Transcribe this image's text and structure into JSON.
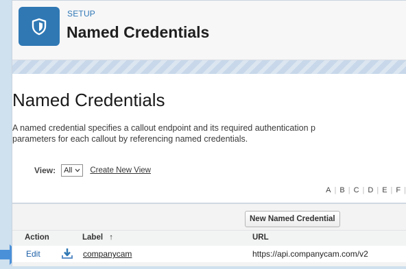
{
  "header": {
    "kicker": "SETUP",
    "title": "Named Credentials"
  },
  "page": {
    "title": "Named Credentials",
    "description_line1": "A named credential specifies a callout endpoint and its required authentication p",
    "description_line2": "parameters for each callout by referencing named credentials."
  },
  "view": {
    "label": "View:",
    "selected": "All",
    "create_link": "Create New View"
  },
  "alphabet": [
    "A",
    "B",
    "C",
    "D",
    "E",
    "F"
  ],
  "list": {
    "new_button": "New Named Credential",
    "columns": {
      "action": "Action",
      "label": "Label",
      "sort_indicator": "↑",
      "url": "URL"
    },
    "rows": [
      {
        "action": "Edit",
        "label": "companycam",
        "url": "https://api.companycam.com/v2"
      }
    ]
  },
  "colors": {
    "brand": "#2f78b4",
    "link": "#1b5fa7",
    "pointer": "#4a90d9"
  }
}
